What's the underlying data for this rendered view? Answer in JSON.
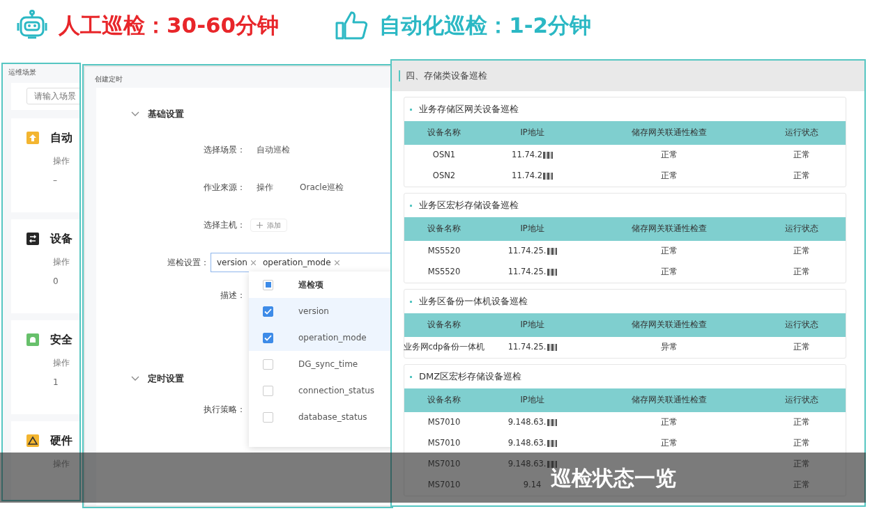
{
  "header": {
    "manual": "人工巡检：30-60分钟",
    "auto": "自动化巡检：1-2分钟"
  },
  "scene_panel": {
    "title": "运维场景",
    "search": {
      "placeholder": "请输入场景"
    },
    "items": [
      {
        "name": "自动",
        "label": "操作",
        "count": "–",
        "color": "#f3b530",
        "kind": "upload"
      },
      {
        "name": "设备",
        "label": "操作",
        "count": "0",
        "color": "#262626",
        "kind": "switch"
      },
      {
        "name": "安全",
        "label": "操作",
        "count": "1",
        "color": "#67c06b",
        "kind": "bell"
      },
      {
        "name": "硬件",
        "label": "操作",
        "color": "#f3b530",
        "kind": "warning"
      }
    ]
  },
  "schedule_dialog": {
    "title": "创建定时",
    "sections": [
      {
        "title": "基础设置",
        "expanded": true,
        "fields": [
          {
            "kind": "text",
            "label": "选择场景：",
            "value": "自动巡检"
          },
          {
            "kind": "pair",
            "label": "作业来源：",
            "value": "操作",
            "value_2": "Oracle巡检"
          },
          {
            "kind": "add",
            "label": "选择主机：",
            "button": "添加"
          },
          {
            "kind": "tags",
            "label": "巡检设置：",
            "tags": [
              "version",
              "operation_mode"
            ]
          },
          {
            "kind": "label",
            "label": "描述："
          }
        ]
      },
      {
        "title": "定时设置",
        "expanded": true,
        "fields": [
          {
            "kind": "label",
            "label": "执行策略："
          }
        ]
      }
    ],
    "dropdown": {
      "header": "巡检项",
      "header_indeterminate": true,
      "items": [
        {
          "label": "version",
          "checked": true
        },
        {
          "label": "operation_mode",
          "checked": true
        },
        {
          "label": "DG_sync_time",
          "checked": false
        },
        {
          "label": "connection_status",
          "checked": false
        },
        {
          "label": "database_status",
          "checked": false
        }
      ]
    }
  },
  "inspection_report": {
    "title": "四、存储类设备巡检",
    "sections": [
      {
        "title": "业务存储区网关设备巡检",
        "columns": [
          "设备名称",
          "IP地址",
          "储存网关联通性检查",
          "运行状态"
        ],
        "rows": [
          {
            "cells": [
              "OSN1",
              "11.74.2",
              "正常",
              "正常"
            ],
            "redacted": true
          },
          {
            "cells": [
              "OSN2",
              "11.74.2",
              "正常",
              "正常"
            ],
            "redacted": true
          }
        ]
      },
      {
        "title": "业务区宏杉存储设备巡检",
        "columns": [
          "设备名称",
          "IP地址",
          "储存网关联通性检查",
          "运行状态"
        ],
        "rows": [
          {
            "cells": [
              "MS5520",
              "11.74.25.",
              "正常",
              "正常"
            ],
            "redacted": true
          },
          {
            "cells": [
              "MS5520",
              "11.74.25.",
              "正常",
              "正常"
            ],
            "redacted": true
          }
        ]
      },
      {
        "title": "业务区备份一体机设备巡检",
        "columns": [
          "设备名称",
          "IP地址",
          "储存网关联通性检查",
          "运行状态"
        ],
        "rows": [
          {
            "cells": [
              "业务网cdp备份一体机",
              "11.74.25.",
              "异常",
              "正常"
            ],
            "redacted": true
          }
        ]
      },
      {
        "title": "DMZ区宏杉存储设备巡检",
        "columns": [
          "设备名称",
          "IP地址",
          "储存网关联通性检查",
          "运行状态"
        ],
        "rows": [
          {
            "cells": [
              "MS7010",
              "9.148.63.",
              "正常",
              "正常"
            ],
            "redacted": true
          },
          {
            "cells": [
              "MS7010",
              "9.148.63.",
              "正常",
              "正常"
            ],
            "redacted": true
          },
          {
            "cells": [
              "MS7010",
              "9.148.63.",
              null,
              "正常"
            ],
            "redacted": true
          },
          {
            "cells": [
              "MS7010",
              "9.14",
              null,
              "正常"
            ],
            "redacted": false
          }
        ]
      }
    ]
  },
  "caption": "巡检状态一览"
}
